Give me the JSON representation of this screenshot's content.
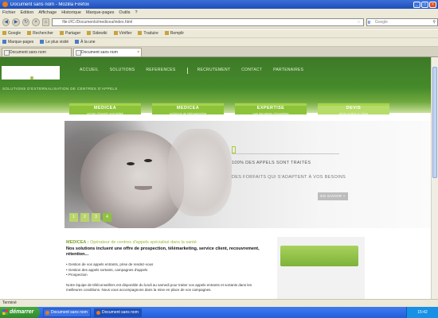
{
  "browser": {
    "title": "Document sans nom - Mozilla Firefox",
    "menu": [
      "Fichier",
      "Edition",
      "Affichage",
      "Historique",
      "Marque-pages",
      "Outils",
      "?"
    ],
    "url": "file:///C:/Documents/medicea/index.html",
    "search_placeholder": "Google",
    "toolbar_items": [
      "Google",
      "Rechercher",
      "Partager",
      "Sidewiki",
      "Vérifier",
      "Traduire",
      "Remplir"
    ],
    "bookmarks": [
      "Marque-pages",
      "Le plus visité",
      "À la une"
    ],
    "tabs": [
      {
        "label": "Document sans nom",
        "active": false
      },
      {
        "label": "Document sans nom",
        "active": true
      }
    ],
    "status": "Terminé"
  },
  "site": {
    "nav": [
      "ACCUEIL",
      "SOLUTIONS",
      "REFERENCES",
      "RECRUTEMENT",
      "CONTACT",
      "PARTENAIRES"
    ],
    "tagline": "SOLUTIONS D'EXTERNALISATION DE CENTRES D'APPELS",
    "subnav": [
      {
        "title": "MEDICEA",
        "sub": "centre d'appels spécialisé",
        "light": false
      },
      {
        "title": "MEDICEA",
        "sub": "solutions de télémarketing",
        "light": false
      },
      {
        "title": "EXPERTISE",
        "sub": "nos domaines d'expertise",
        "light": false
      },
      {
        "title": "DEVIS",
        "sub": "devis gratuit en ligne",
        "light": true
      }
    ],
    "hero": {
      "heading": "100% DES APPELS SONT TRAITÉS",
      "subheading": "DES FORFAITS QUI S'ADAPTENT À VOS BESOINS",
      "button": "EN SAVOIR +",
      "dots": [
        "1",
        "2",
        "3",
        "4"
      ],
      "active_dot": 4
    },
    "intro": {
      "brand": "MEDICEA :",
      "headline": "Opérateur de centres d'appels spécialisé dans la santé",
      "bold": "Nos solutions incluent une offre de prospection, télémarketing, service client, recouvrement, rétention..."
    },
    "list": [
      "• Gestion de vos appels entrants, prise de rendez-vous",
      "• Gestion des appels sortants, campagnes d'appels",
      "• Prospection"
    ],
    "footer_para": "Notre équipe de téléconseillers est disponible du lundi au samedi pour traiter vos appels entrants et sortants dans les meilleures conditions. Nous vous accompagnons dans la mise en place de vos campagnes."
  },
  "taskbar": {
    "start": "démarrer",
    "tasks": [
      {
        "label": "Document sans nom",
        "active": false
      },
      {
        "label": "Document sans nom",
        "active": true
      }
    ],
    "clock": "15:42"
  },
  "colors": {
    "brand_green": "#468a2b",
    "accent_green": "#8cc33a",
    "light_green": "#b6dc6a"
  }
}
